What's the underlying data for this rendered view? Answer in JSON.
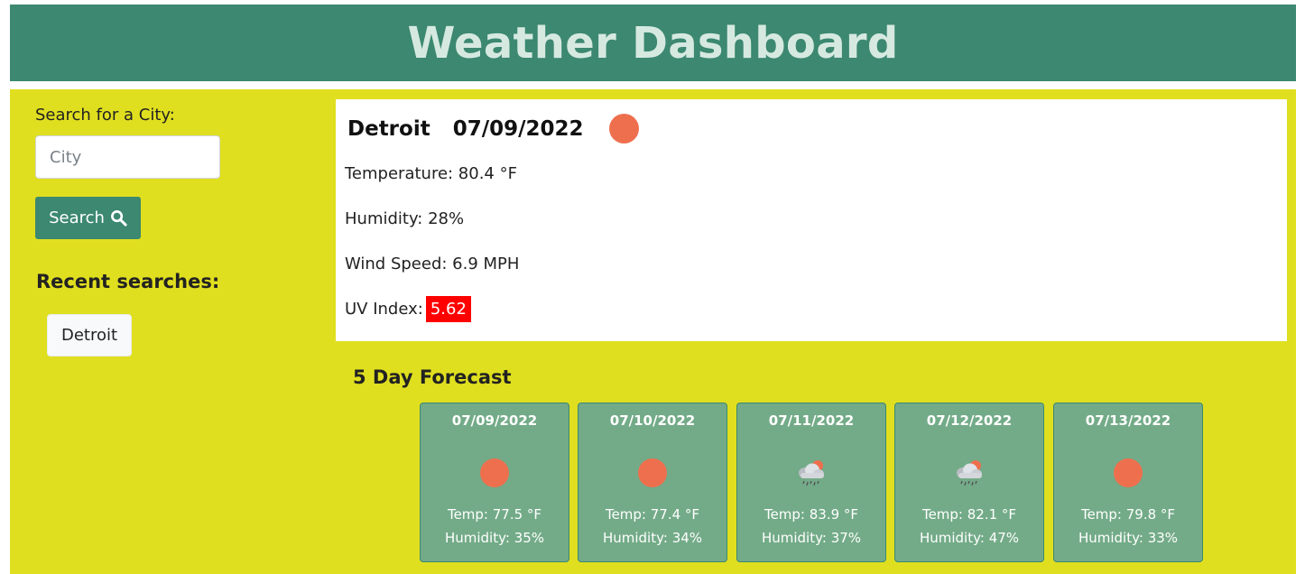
{
  "header": {
    "title": "Weather Dashboard"
  },
  "sidebar": {
    "search_label": "Search for a City:",
    "search_placeholder": "City",
    "search_value": "",
    "search_button": "Search",
    "search_icon": "search-icon",
    "recent_title": "Recent searches:",
    "recent": [
      "Detroit"
    ]
  },
  "current": {
    "city": "Detroit",
    "date": "07/09/2022",
    "icon": "sun-icon",
    "temperature": "Temperature: 80.4 °F",
    "humidity": "Humidity: 28%",
    "wind": "Wind Speed: 6.9 MPH",
    "uv_label": "UV Index:",
    "uv_value": "5.62",
    "uv_color": "#ff0000"
  },
  "forecast": {
    "title": "5 Day Forecast",
    "days": [
      {
        "date": "07/09/2022",
        "icon": "sun-icon",
        "temp": "Temp: 77.5 °F",
        "humidity": "Humidity: 35%"
      },
      {
        "date": "07/10/2022",
        "icon": "sun-icon",
        "temp": "Temp: 77.4 °F",
        "humidity": "Humidity: 34%"
      },
      {
        "date": "07/11/2022",
        "icon": "rain-cloud-icon",
        "temp": "Temp: 83.9 °F",
        "humidity": "Humidity: 37%"
      },
      {
        "date": "07/12/2022",
        "icon": "rain-cloud-icon",
        "temp": "Temp: 82.1 °F",
        "humidity": "Humidity: 47%"
      },
      {
        "date": "07/13/2022",
        "icon": "sun-icon",
        "temp": "Temp: 79.8 °F",
        "humidity": "Humidity: 33%"
      }
    ]
  },
  "colors": {
    "header_bg": "#3c8870",
    "main_bg": "#e0df1f",
    "card_bg": "#73ab88",
    "sun": "#ee6f4e"
  }
}
